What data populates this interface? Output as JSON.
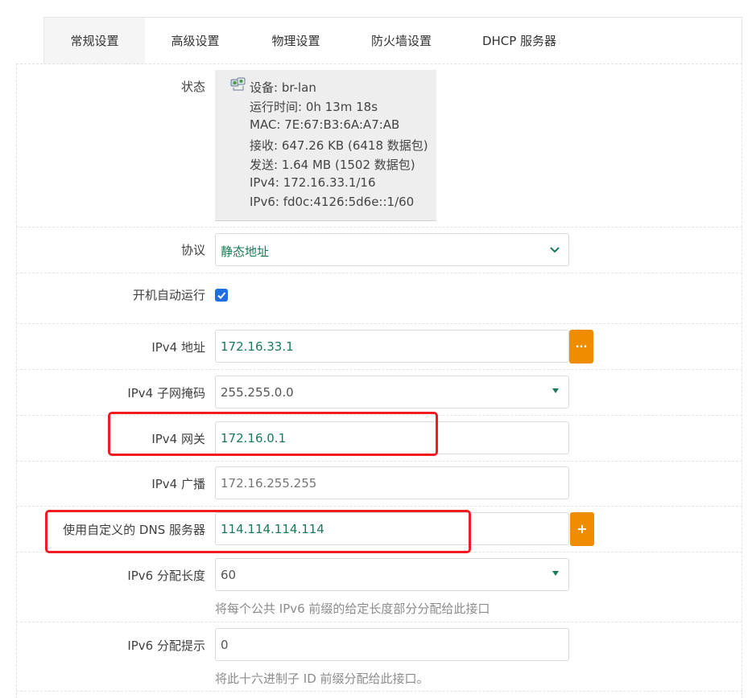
{
  "tabs": [
    {
      "label": "常规设置",
      "active": true
    },
    {
      "label": "高级设置"
    },
    {
      "label": "物理设置"
    },
    {
      "label": "防火墙设置"
    },
    {
      "label": "DHCP 服务器"
    }
  ],
  "status": {
    "label": "状态",
    "device": "设备: br-lan",
    "uptime": "运行时间: 0h 13m 18s",
    "mac": "MAC: 7E:67:B3:6A:A7:AB",
    "rx": "接收: 647.26 KB (6418 数据包)",
    "tx": "发送: 1.64 MB (1502 数据包)",
    "ipv4": "IPv4: 172.16.33.1/16",
    "ipv6": "IPv6: fd0c:4126:5d6e::1/60"
  },
  "protocol": {
    "label": "协议",
    "value": "静态地址"
  },
  "autostart": {
    "label": "开机自动运行",
    "checked": true
  },
  "ipv4_address": {
    "label": "IPv4 地址",
    "value": "172.16.33.1",
    "button": "..."
  },
  "ipv4_netmask": {
    "label": "IPv4 子网掩码",
    "value": "255.255.0.0"
  },
  "ipv4_gateway": {
    "label": "IPv4 网关",
    "value": "172.16.0.1"
  },
  "ipv4_broadcast": {
    "label": "IPv4 广播",
    "placeholder": "172.16.255.255"
  },
  "dns": {
    "label": "使用自定义的 DNS 服务器",
    "value": "114.114.114.114",
    "button": "+"
  },
  "ipv6_assign": {
    "label": "IPv6 分配长度",
    "value": "60",
    "hint": "将每个公共 IPv6 前缀的给定长度部分分配给此接口"
  },
  "ipv6_hint": {
    "label": "IPv6 分配提示",
    "value": "0",
    "hint": "将此十六进制子 ID 前缀分配给此接口。"
  },
  "colors": {
    "accent": "#f08c00",
    "highlight": "#ef1c24",
    "value_green": "#1a7a55",
    "checkbox": "#1f6fe0"
  }
}
